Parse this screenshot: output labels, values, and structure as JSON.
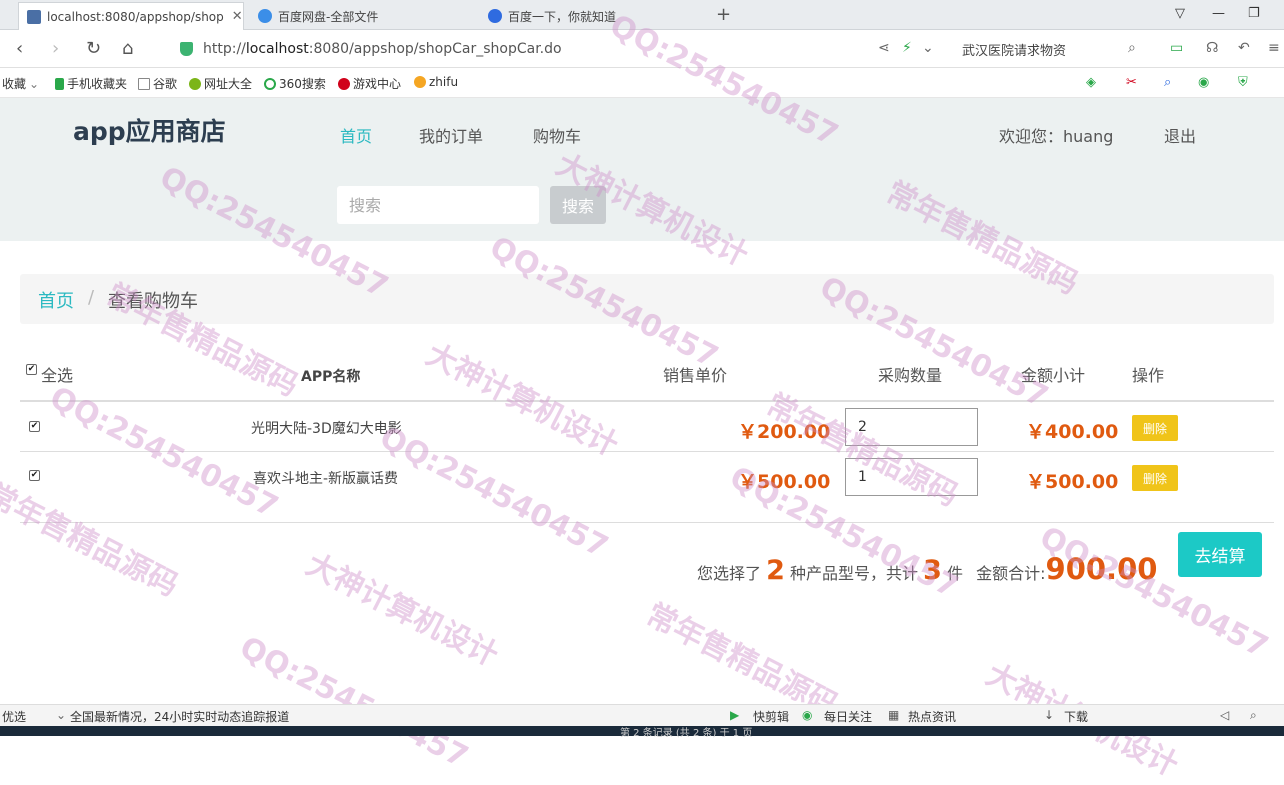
{
  "browser": {
    "tabs": [
      {
        "title": "localhost:8080/appshop/shop",
        "active": true,
        "color": "#4a6fa5"
      },
      {
        "title": "百度网盘-全部文件",
        "active": false,
        "color": "#3b8ee8"
      },
      {
        "title": "百度一下，你就知道",
        "active": false,
        "color": "#2f6be0"
      }
    ],
    "url_prefix": "http://",
    "url_host": "localhost",
    "url_rest": ":8080/appshop/shopCar_shopCar.do",
    "hot_search": "武汉医院请求物资",
    "bookmarks": [
      "收藏",
      "手机收藏夹",
      "谷歌",
      "网址大全",
      "360搜索",
      "游戏中心",
      "zhifu"
    ]
  },
  "header": {
    "brand": "app应用商店",
    "nav": [
      "首页",
      "我的订单",
      "购物车"
    ],
    "welcome": "欢迎您：huang",
    "logout": "退出",
    "search_placeholder": "搜索",
    "search_button": "搜索"
  },
  "breadcrumb": {
    "home": "首页",
    "separator": "/",
    "current": "查看购物车"
  },
  "cart": {
    "columns": {
      "select_all": "全选",
      "name": "APP名称",
      "price": "销售单价",
      "quantity": "采购数量",
      "subtotal": "金额小计",
      "action": "操作"
    },
    "rows": [
      {
        "checked": true,
        "name": "光明大陆-3D魔幻大电影",
        "price": "￥200.00",
        "quantity": "2",
        "subtotal": "￥400.00",
        "delete": "删除"
      },
      {
        "checked": true,
        "name": "喜欢斗地主-新版赢话费",
        "price": "￥500.00",
        "quantity": "1",
        "subtotal": "￥500.00",
        "delete": "删除"
      }
    ],
    "summary": {
      "text1": "您选择了",
      "types": "2",
      "text2": "种产品型号，共计",
      "count": "3",
      "text3": "件",
      "text4": "金额合计:",
      "total": "900.00"
    },
    "checkout": "去结算"
  },
  "statusbar": {
    "left": "优选",
    "news": "全国最新情况，24小时实时动态追踪报道",
    "items": [
      "快剪辑",
      "每日关注",
      "热点资讯",
      "下载"
    ]
  },
  "taskbar": {
    "text": "第 2 条记录 (共 2 条) 于 1 页"
  },
  "watermarks": [
    "QQ:254540457",
    "常年售精品源码",
    "大神计算机设计"
  ],
  "colors": {
    "accent": "#2bb9c1",
    "price": "#e05a10",
    "delete_button": "#f0c419",
    "checkout_button": "#1cc9c6"
  }
}
